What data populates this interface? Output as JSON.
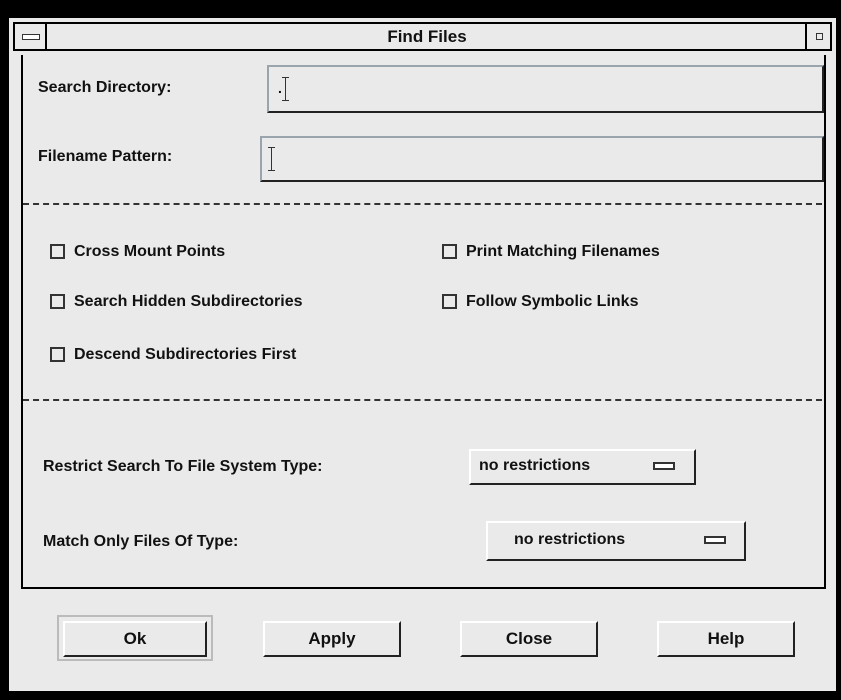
{
  "window": {
    "title": "Find Files"
  },
  "fields": {
    "search_directory": {
      "label": "Search Directory:",
      "value": "."
    },
    "filename_pattern": {
      "label": "Filename Pattern:",
      "value": ""
    }
  },
  "options": [
    {
      "label": "Cross Mount Points",
      "checked": false
    },
    {
      "label": "Print Matching Filenames",
      "checked": false
    },
    {
      "label": "Search Hidden Subdirectories",
      "checked": false
    },
    {
      "label": "Follow Symbolic Links",
      "checked": false
    },
    {
      "label": "Descend Subdirectories First",
      "checked": false
    }
  ],
  "restrictions": {
    "fs_type": {
      "label": "Restrict Search To File System Type:",
      "value": "no restrictions"
    },
    "file_type": {
      "label": "Match Only Files Of Type:",
      "value": "no restrictions"
    }
  },
  "buttons": {
    "ok": "Ok",
    "apply": "Apply",
    "close": "Close",
    "help": "Help"
  }
}
